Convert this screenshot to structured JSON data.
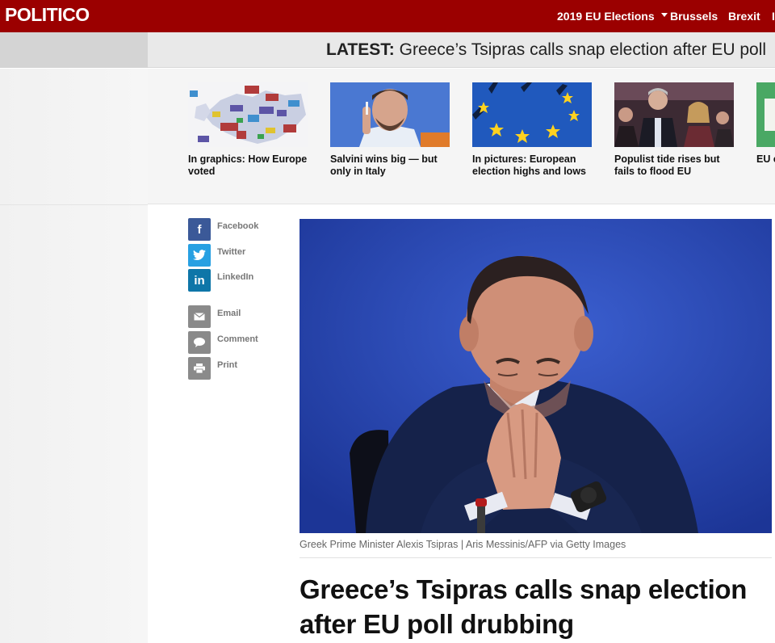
{
  "header": {
    "logo": "POLITICO",
    "nav": [
      {
        "label": "2019 EU Elections"
      },
      {
        "label": "Brussels"
      },
      {
        "label": "Brexit"
      },
      {
        "label": "I"
      }
    ]
  },
  "latest": {
    "prefix": "LATEST:",
    "text": "Greece’s Tsipras calls snap election after EU poll"
  },
  "carousel": [
    {
      "caption": "In graphics: How Europe voted"
    },
    {
      "caption": "Salvini wins big — but only in Italy"
    },
    {
      "caption": "In pictures: European election highs and lows"
    },
    {
      "caption": "Populist tide rises but fails to flood EU"
    },
    {
      "caption": "EU e lose"
    }
  ],
  "social": [
    {
      "label": "Facebook",
      "icon": "facebook-icon"
    },
    {
      "label": "Twitter",
      "icon": "twitter-icon"
    },
    {
      "label": "LinkedIn",
      "icon": "linkedin-icon"
    },
    {
      "label": "Email",
      "icon": "email-icon"
    },
    {
      "label": "Comment",
      "icon": "comment-icon"
    },
    {
      "label": "Print",
      "icon": "print-icon"
    }
  ],
  "article": {
    "image_credit": "Greek Prime Minister Alexis Tsipras | Aris Messinis/AFP via Getty Images",
    "headline": "Greece’s Tsipras calls snap election after EU poll drubbing"
  },
  "colors": {
    "brand": "#9b0000",
    "facebook": "#3b5998",
    "twitter": "#27a0e2",
    "linkedin": "#0e76a8"
  }
}
